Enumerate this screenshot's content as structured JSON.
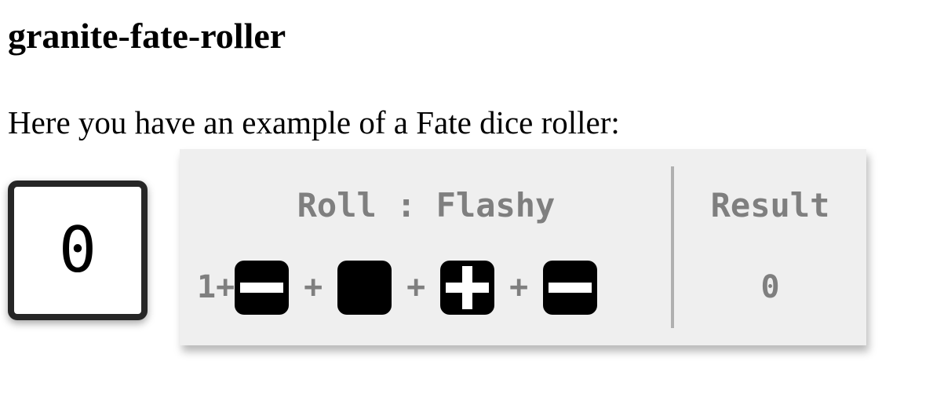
{
  "page": {
    "title": "granite-fate-roller",
    "intro": "Here you have an example of a Fate dice roller:"
  },
  "roller": {
    "display_value": "0"
  },
  "tooltip": {
    "roll_label": "Roll : Flashy",
    "modifier": "1+",
    "separator": "+",
    "dice": [
      {
        "face": "minus",
        "icon": "minus-die-icon"
      },
      {
        "face": "blank",
        "icon": "blank-die-icon"
      },
      {
        "face": "plus",
        "icon": "plus-die-icon"
      },
      {
        "face": "minus",
        "icon": "minus-die-icon"
      }
    ],
    "result_label": "Result",
    "result_value": "0"
  },
  "colors": {
    "tooltip_background": "#efefef",
    "tooltip_text": "#7f7f7f",
    "die_background": "#000000",
    "box_border": "#262626"
  }
}
